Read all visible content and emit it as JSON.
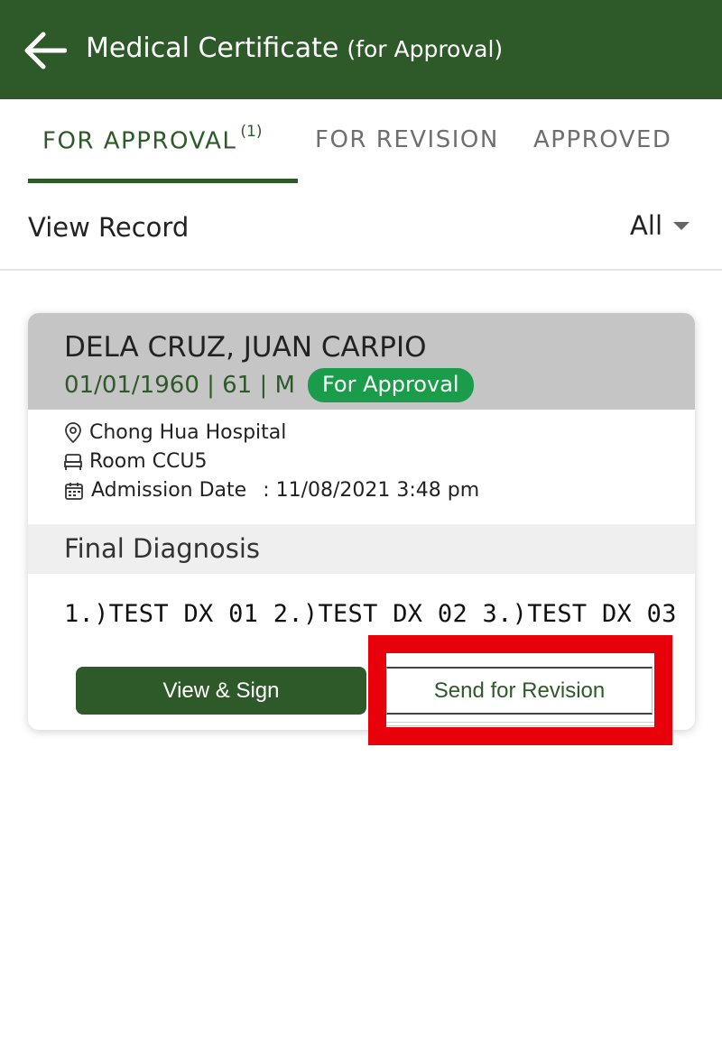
{
  "appbar": {
    "title": "Medical Certificate",
    "subtitle": "(for Approval)",
    "back_icon": "arrow-left-icon",
    "background": "#2e5a2a"
  },
  "tabs": [
    {
      "label": "FOR APPROVAL",
      "count": "(1)",
      "active": true
    },
    {
      "label": "FOR REVISION",
      "active": false
    },
    {
      "label": "APPROVED",
      "active": false
    }
  ],
  "filter": {
    "label": "View Record",
    "selected": "All"
  },
  "record": {
    "patient_name": "DELA CRUZ, JUAN CARPIO",
    "meta": "01/01/1960 | 61 | M",
    "status": "For Approval",
    "hospital": "Chong Hua Hospital",
    "room": "Room CCU5",
    "admission_label": "Admission Date",
    "admission_value": ": 11/08/2021 3:48 pm",
    "diagnosis_title": "Final Diagnosis",
    "diagnosis_text": "1.)TEST DX 01 2.)TEST DX 02 3.)TEST DX 03",
    "actions": {
      "sign": "View & Sign",
      "revision": "Send for Revision"
    }
  },
  "colors": {
    "primary": "#2e5a2a",
    "badge": "#1a9c4a",
    "highlight": "#e8000b"
  }
}
